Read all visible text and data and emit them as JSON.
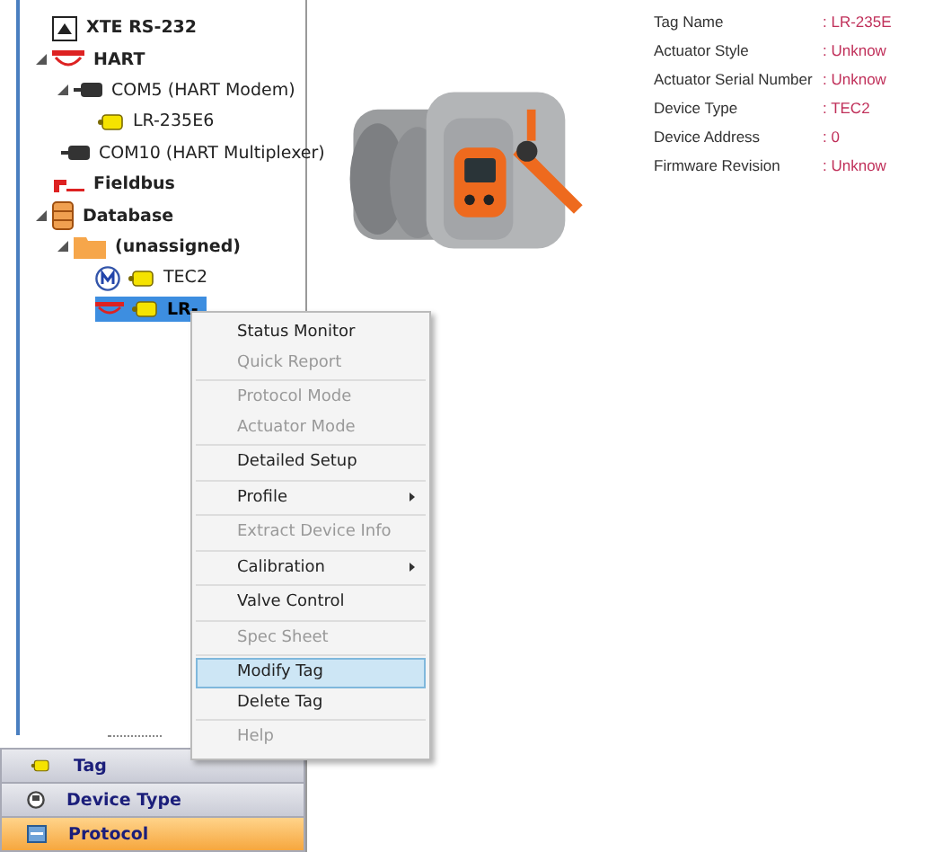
{
  "tree": [
    {
      "label": "XTE RS-232",
      "kind": "interface",
      "selected": false
    },
    {
      "label": "HART",
      "kind": "protocol",
      "selected": false,
      "expanded": true,
      "children": [
        {
          "label": "COM5 (HART Modem)",
          "kind": "port",
          "selected": false,
          "expanded": true,
          "children": [
            {
              "label": "LR-235E6",
              "kind": "device",
              "selected": false
            }
          ]
        },
        {
          "label": "COM10 (HART Multiplexer)",
          "kind": "port",
          "selected": false
        }
      ]
    },
    {
      "label": "Fieldbus",
      "kind": "fieldbus",
      "selected": false
    },
    {
      "label": "Database",
      "kind": "database",
      "selected": false,
      "expanded": true,
      "children": [
        {
          "label": "(unassigned)",
          "kind": "folder",
          "selected": false,
          "expanded": true,
          "children": [
            {
              "label": "TEC2",
              "kind": "m-device",
              "selected": false
            },
            {
              "label": "LR-",
              "kind": "hart-device",
              "selected": true
            }
          ]
        }
      ]
    }
  ],
  "image": {
    "kind": "picture"
  },
  "properties": [
    {
      "label": "Tag Name",
      "value": ": LR-235E"
    },
    {
      "label": "Actuator Style",
      "value": ": Unknow"
    },
    {
      "label": "Actuator Serial Number",
      "value": ": Unknow"
    },
    {
      "label": "Device Type",
      "value": ": TEC2"
    },
    {
      "label": "Device Address",
      "value": ": 0"
    },
    {
      "label": "Firmware Revision",
      "value": ": Unknow"
    }
  ],
  "context_menu": [
    [
      {
        "label": "Status Monitor",
        "disabled": false,
        "selected": false
      },
      {
        "label": "Quick Report",
        "disabled": true,
        "selected": false
      }
    ],
    [
      {
        "label": "Protocol Mode",
        "disabled": true,
        "selected": false
      },
      {
        "label": "Actuator Mode",
        "disabled": true,
        "selected": false
      }
    ],
    [
      {
        "label": "Detailed Setup",
        "disabled": false,
        "selected": false
      }
    ],
    [
      {
        "label": "Profile",
        "disabled": false,
        "selected": false,
        "submenu": true
      }
    ],
    [
      {
        "label": "Extract Device Info",
        "disabled": true,
        "selected": false
      }
    ],
    [
      {
        "label": "Calibration",
        "disabled": false,
        "selected": false,
        "submenu": true
      }
    ],
    [
      {
        "label": "Valve Control",
        "disabled": false,
        "selected": false
      }
    ],
    [
      {
        "label": "Spec Sheet",
        "disabled": true,
        "selected": false
      }
    ],
    [
      {
        "label": "Modify Tag",
        "disabled": false,
        "selected": true
      },
      {
        "label": "Delete Tag",
        "disabled": false,
        "selected": false
      }
    ],
    [
      {
        "label": "Help",
        "disabled": true,
        "selected": false
      }
    ]
  ],
  "nav": [
    {
      "label": "Tag",
      "kind": "tag",
      "selected": false
    },
    {
      "label": "Device Type",
      "kind": "device-type",
      "selected": false
    },
    {
      "label": "Protocol",
      "kind": "protocol",
      "selected": true
    }
  ]
}
